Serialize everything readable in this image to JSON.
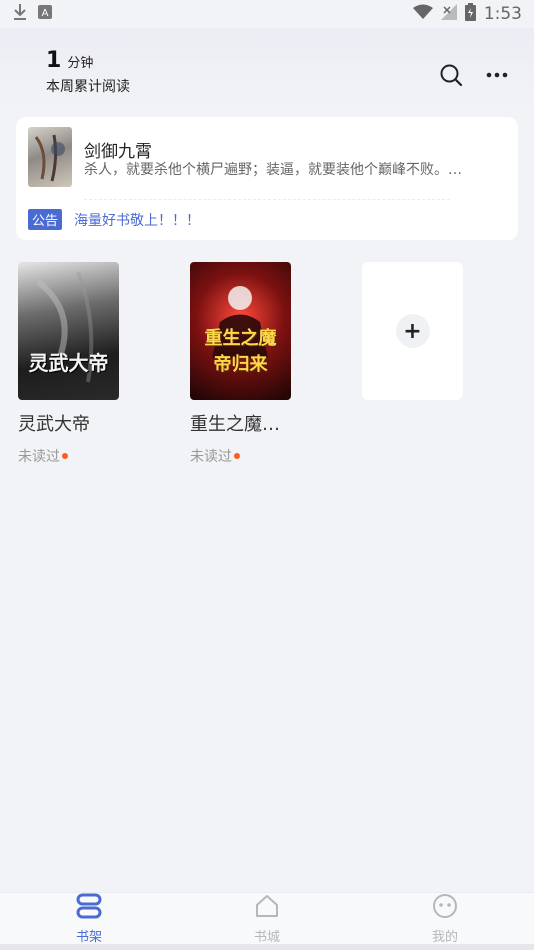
{
  "status_bar": {
    "time": "1:53",
    "icons": [
      "download-icon",
      "a-icon",
      "wifi-icon",
      "no-signal-icon",
      "battery-charging-icon"
    ]
  },
  "header": {
    "reading_minutes": "1",
    "reading_unit": "分钟",
    "reading_label": "本周累计阅读",
    "icons": [
      "search-icon",
      "more-icon"
    ]
  },
  "recommend": {
    "title": "剑御九霄",
    "description": "杀人，就要杀他个横尸遍野；装逼，就要装他个巅峰不败。…",
    "notice_badge": "公告",
    "notice_text": "海量好书敬上！！！"
  },
  "books": [
    {
      "title": "灵武大帝",
      "cover_text": "灵武大帝",
      "status": "未读过"
    },
    {
      "title": "重生之魔…",
      "cover_text": "重生之魔帝归来",
      "status": "未读过"
    }
  ],
  "add_button": "+",
  "nav": {
    "items": [
      {
        "label": "书架",
        "icon": "bookshelf-icon",
        "active": true
      },
      {
        "label": "书城",
        "icon": "home-icon",
        "active": false
      },
      {
        "label": "我的",
        "icon": "profile-icon",
        "active": false
      }
    ]
  },
  "colors": {
    "accent": "#4a6bd3",
    "unread_dot": "#ff5a1f",
    "background": "#f2f3f6"
  }
}
